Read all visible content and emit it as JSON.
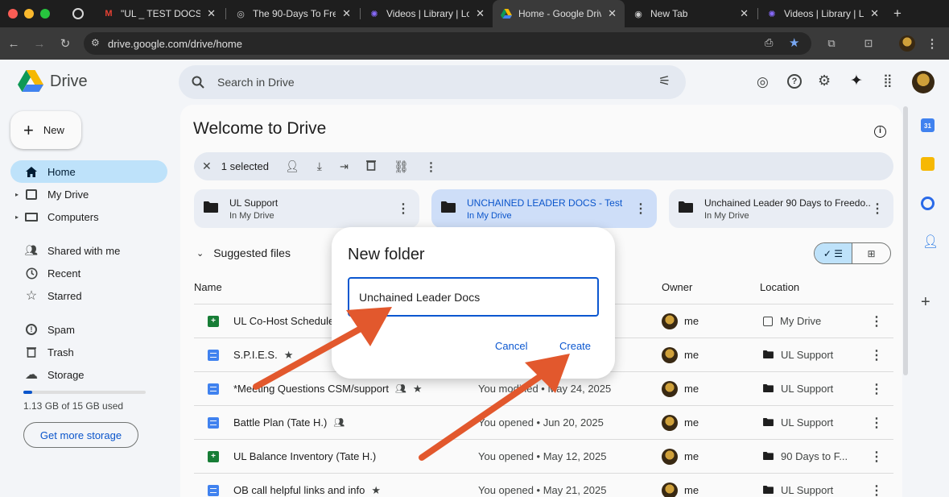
{
  "browser": {
    "tabs": [
      {
        "label": "\"UL _ TEST DOCS\" -",
        "icon": "gmail-icon"
      },
      {
        "label": "The 90-Days To Fre",
        "icon": "site-icon"
      },
      {
        "label": "Videos | Library | Loo",
        "icon": "loom-icon"
      },
      {
        "label": "Home - Google Drive",
        "icon": "drive-icon"
      },
      {
        "label": "New Tab",
        "icon": "chrome-icon"
      },
      {
        "label": "Videos | Library | Loo",
        "icon": "loom-icon"
      }
    ],
    "url": "drive.google.com/drive/home"
  },
  "drive": {
    "product": "Drive",
    "search_placeholder": "Search in Drive",
    "new_label": "New",
    "nav": [
      {
        "label": "Home",
        "icon": "home-icon"
      },
      {
        "label": "My Drive",
        "icon": "my-drive-icon"
      },
      {
        "label": "Computers",
        "icon": "computer-icon"
      },
      {
        "label": "Shared with me",
        "icon": "people-icon"
      },
      {
        "label": "Recent",
        "icon": "clock-icon"
      },
      {
        "label": "Starred",
        "icon": "star-icon"
      },
      {
        "label": "Spam",
        "icon": "spam-icon"
      },
      {
        "label": "Trash",
        "icon": "trash-icon"
      },
      {
        "label": "Storage",
        "icon": "cloud-icon"
      }
    ],
    "storage_text": "1.13 GB of 15 GB used",
    "storage_used_fraction": 0.075,
    "get_storage": "Get more storage",
    "welcome": "Welcome to Drive",
    "selection_text": "1 selected",
    "folders": [
      {
        "name": "UL Support",
        "location": "In My Drive"
      },
      {
        "name": "UNCHAINED LEADER DOCS - Test",
        "location": "In My Drive"
      },
      {
        "name": "Unchained Leader 90 Days to Freedo...",
        "location": "In My Drive"
      }
    ],
    "suggested_label": "Suggested files",
    "columns": {
      "name": "Name",
      "owner": "Owner",
      "location": "Location"
    },
    "files": [
      {
        "name": "UL Co-Host Schedule",
        "type": "sheet",
        "shared": false,
        "starred": false,
        "activity": "",
        "owner": "me",
        "location": "My Drive",
        "loc_icon": "my-drive-icon"
      },
      {
        "name": "S.P.I.E.S.",
        "type": "doc",
        "shared": false,
        "starred": true,
        "activity": "",
        "owner": "me",
        "location": "UL Support",
        "loc_icon": "folder-icon"
      },
      {
        "name": "*Meeting Questions CSM/support",
        "type": "doc",
        "shared": true,
        "starred": true,
        "activity": "You modified • May 24, 2025",
        "owner": "me",
        "location": "UL Support",
        "loc_icon": "folder-icon"
      },
      {
        "name": "Battle Plan (Tate H.)",
        "type": "doc",
        "shared": true,
        "starred": false,
        "activity": "You opened • Jun 20, 2025",
        "owner": "me",
        "location": "UL Support",
        "loc_icon": "folder-icon"
      },
      {
        "name": "UL Balance Inventory (Tate H.)",
        "type": "sheet",
        "shared": false,
        "starred": false,
        "activity": "You opened • May 12, 2025",
        "owner": "me",
        "location": "90 Days to F...",
        "loc_icon": "folder-icon"
      },
      {
        "name": "OB call helpful links and info",
        "type": "doc",
        "shared": false,
        "starred": true,
        "activity": "You opened • May 21, 2025",
        "owner": "me",
        "location": "UL Support",
        "loc_icon": "folder-icon"
      }
    ]
  },
  "dialog": {
    "title": "New folder",
    "input_value": "Unchained Leader Docs",
    "cancel": "Cancel",
    "create": "Create"
  },
  "colors": {
    "accent": "#0b57d0",
    "selection": "#c2e7ff",
    "annotation_arrow": "#e2582d",
    "sheet": "#188038",
    "doc": "#4285f4"
  }
}
